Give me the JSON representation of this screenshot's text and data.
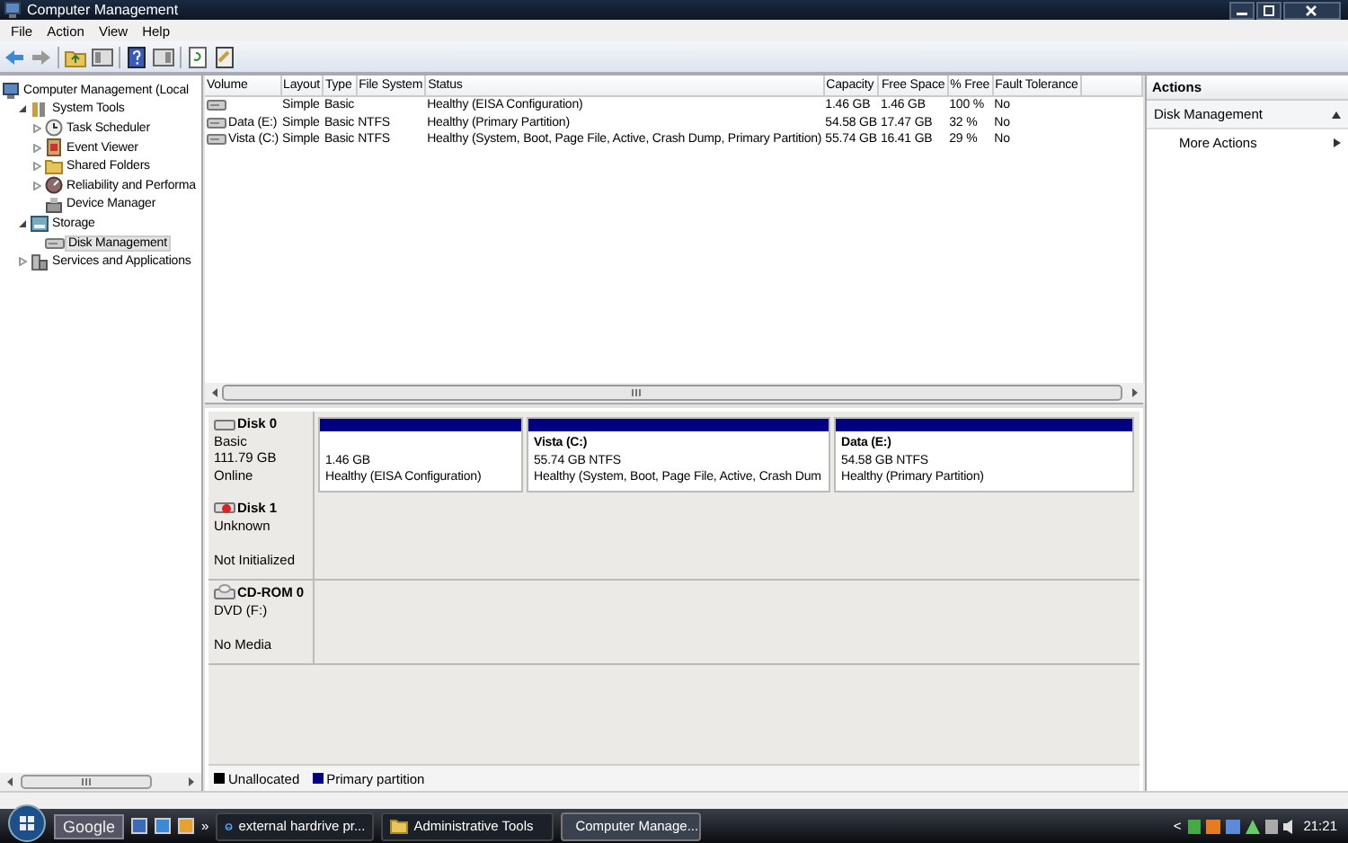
{
  "window": {
    "title": "Computer Management"
  },
  "menu": [
    "File",
    "Action",
    "View",
    "Help"
  ],
  "tree": [
    {
      "label": "Computer Management (Local",
      "selected": false,
      "children": [
        {
          "label": "System Tools",
          "expanded": true,
          "selected": false,
          "children": [
            {
              "label": "Task Scheduler",
              "expanded": false,
              "selected": false
            },
            {
              "label": "Event Viewer",
              "expanded": false,
              "selected": false
            },
            {
              "label": "Shared Folders",
              "expanded": false,
              "selected": false
            },
            {
              "label": "Reliability and Performa",
              "expanded": false,
              "selected": false
            },
            {
              "label": "Device Manager",
              "selected": false
            }
          ]
        },
        {
          "label": "Storage",
          "expanded": true,
          "selected": false,
          "children": [
            {
              "label": "Disk Management",
              "selected": true
            }
          ]
        },
        {
          "label": "Services and Applications",
          "expanded": false,
          "selected": false
        }
      ]
    }
  ],
  "volumes": {
    "columns": [
      "Volume",
      "Layout",
      "Type",
      "File System",
      "Status",
      "Capacity",
      "Free Space",
      "% Free",
      "Fault Tolerance"
    ],
    "rows": [
      [
        "",
        "Simple",
        "Basic",
        "",
        "Healthy (EISA Configuration)",
        "1.46 GB",
        "1.46 GB",
        "100 %",
        "No"
      ],
      [
        "Data (E:)",
        "Simple",
        "Basic",
        "NTFS",
        "Healthy (Primary Partition)",
        "54.58 GB",
        "17.47 GB",
        "32 %",
        "No"
      ],
      [
        "Vista (C:)",
        "Simple",
        "Basic",
        "NTFS",
        "Healthy (System, Boot, Page File, Active, Crash Dump, Primary Partition)",
        "55.74 GB",
        "16.41 GB",
        "29 %",
        "No"
      ]
    ]
  },
  "disks": [
    {
      "name": "Disk 0",
      "kind": "disk",
      "type": "Basic",
      "size": "111.79 GB",
      "state": "Online",
      "partitions": [
        {
          "size": "1.46 GB",
          "status": "Healthy (EISA Configuration)",
          "color": "#000080"
        },
        {
          "title": "Vista  (C:)",
          "size": "55.74 GB NTFS",
          "status": "Healthy (System, Boot, Page File, Active, Crash Dum",
          "color": "#000080"
        },
        {
          "title": "Data  (E:)",
          "size": "54.58 GB NTFS",
          "status": "Healthy (Primary Partition)",
          "color": "#000080"
        }
      ]
    },
    {
      "name": "Disk 1",
      "kind": "disk-error",
      "type": "Unknown",
      "state": "Not Initialized"
    },
    {
      "name": "CD-ROM 0",
      "kind": "cdrom",
      "type": "DVD (F:)",
      "state": "No Media"
    }
  ],
  "legend": [
    {
      "label": "Unallocated",
      "color": "#000000"
    },
    {
      "label": "Primary partition",
      "color": "#000080"
    }
  ],
  "actions": {
    "title": "Actions",
    "section": "Disk Management",
    "items": [
      "More Actions"
    ]
  },
  "taskbar": {
    "search": "Google",
    "more": "»",
    "tasks": [
      {
        "label": "external hardrive pr...",
        "selected": false
      },
      {
        "label": "Administrative Tools",
        "selected": false
      },
      {
        "label": "Computer Manage...",
        "selected": true
      }
    ],
    "tray_arrow": "<",
    "clock": "21:21"
  }
}
